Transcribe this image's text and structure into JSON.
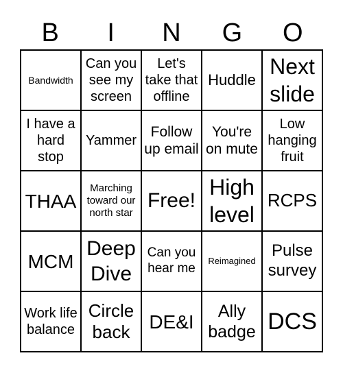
{
  "header": [
    "B",
    "I",
    "N",
    "G",
    "O"
  ],
  "cells": [
    "Bandwidth",
    "Can you see my screen",
    "Let's take that offline",
    "Huddle",
    "Next slide",
    "I have a hard stop",
    "Yammer",
    "Follow up email",
    "You're on mute",
    "Low hanging fruit",
    "THAA",
    "Marching toward our north star",
    "Free!",
    "High level",
    "RCPS",
    "MCM",
    "Deep Dive",
    "Can you hear me",
    "Reimagined",
    "Pulse survey",
    "Work life balance",
    "Circle back",
    "DE&I",
    "Ally badge",
    "DCS"
  ]
}
